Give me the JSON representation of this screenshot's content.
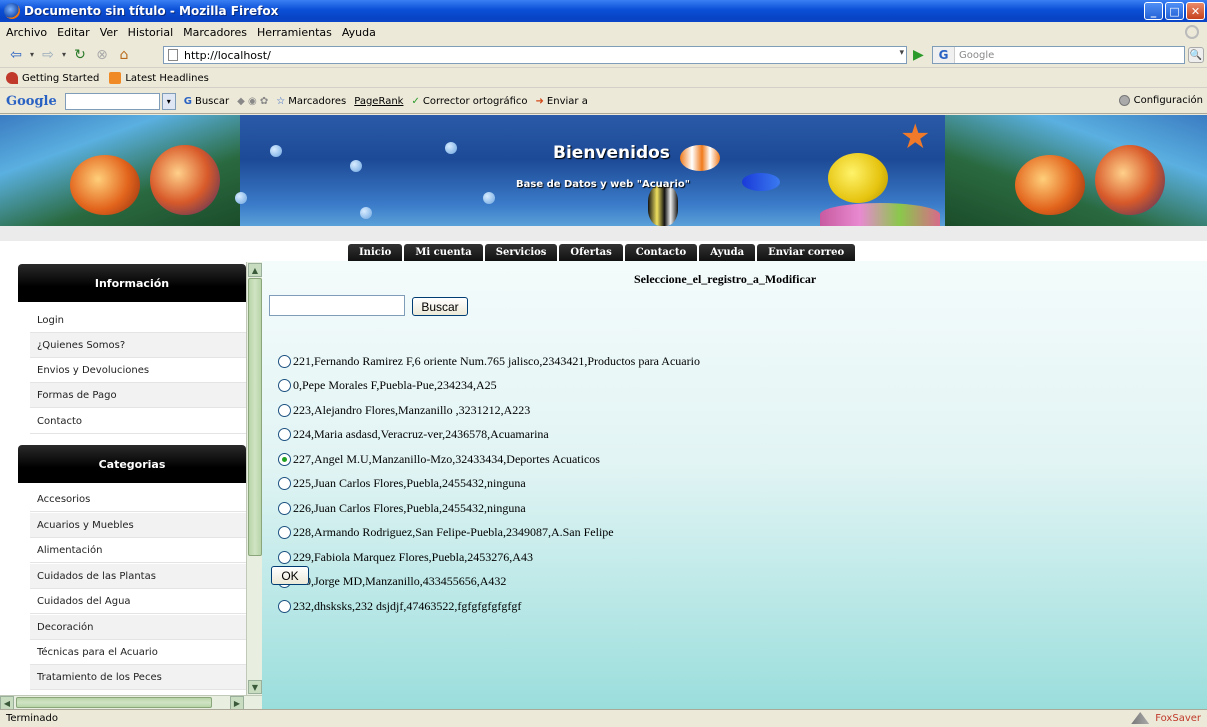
{
  "window": {
    "title": "Documento sin título - Mozilla Firefox"
  },
  "menu": [
    "Archivo",
    "Editar",
    "Ver",
    "Historial",
    "Marcadores",
    "Herramientas",
    "Ayuda"
  ],
  "nav": {
    "url": "http://localhost/",
    "search_placeholder": "Google"
  },
  "bookmarks": [
    "Getting Started",
    "Latest Headlines"
  ],
  "google_toolbar": {
    "logo": "Google",
    "items": [
      "Buscar",
      "Marcadores",
      "PageRank",
      "Corrector ortográfico",
      "Enviar a"
    ],
    "config": "Configuración"
  },
  "banner": {
    "title": "Bienvenidos",
    "subtitle": "Base de Datos y web \"Acuario\""
  },
  "tabs": [
    "Inicio",
    "Mi cuenta",
    "Servicios",
    "Ofertas",
    "Contacto",
    "Ayuda",
    "Enviar correo"
  ],
  "sidebar": {
    "info_title": "Información",
    "info_items": [
      "Login",
      "¿Quienes Somos?",
      "Envios y Devoluciones",
      "Formas de Pago",
      "Contacto"
    ],
    "cat_title": "Categorias",
    "cat_items": [
      "Accesorios",
      "Acuarios y Muebles",
      "Alimentación",
      "Cuidados de las Plantas",
      "Cuidados del Agua",
      "Decoración",
      "Técnicas para el Acuario",
      "Tratamiento de los Peces"
    ]
  },
  "main": {
    "title": "Seleccione_el_registro_a_Modificar",
    "search_value": "",
    "search_button": "Buscar",
    "ok_button": "OK",
    "selected_index": 4,
    "records": [
      "221,Fernando Ramirez F,6 oriente Num.765 jalisco,2343421,Productos para Acuario",
      "0,Pepe Morales F,Puebla-Pue,234234,A25",
      "223,Alejandro Flores,Manzanillo ,3231212,A223",
      "224,Maria asdasd,Veracruz-ver,2436578,Acuamarina",
      "227,Angel M.U,Manzanillo-Mzo,32433434,Deportes Acuaticos",
      "225,Juan Carlos Flores,Puebla,2455432,ninguna",
      "226,Juan Carlos Flores,Puebla,2455432,ninguna",
      "228,Armando Rodriguez,San Felipe-Puebla,2349087,A.San Felipe",
      "229,Fabiola Marquez Flores,Puebla,2453276,A43",
      "230,Jorge MD,Manzanillo,433455656,A432",
      "232,dhsksks,232 dsjdjf,47463522,fgfgfgfgfgfgf"
    ]
  },
  "status": {
    "text": "Terminado",
    "addon": "FoxSaver"
  }
}
